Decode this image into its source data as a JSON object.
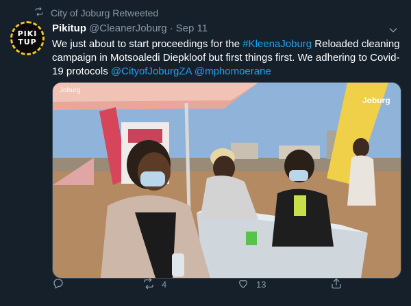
{
  "retweet_context": {
    "text": "City of Joburg Retweeted",
    "icon": "retweet-icon"
  },
  "author": {
    "display_name": "Pikitup",
    "handle": "@CleanerJoburg",
    "separator": "·",
    "date": "Sep 11",
    "avatar_line1": "PIKI",
    "avatar_line2": "TUP"
  },
  "tweet": {
    "text_part1": "We just about to start proceedings for the ",
    "hashtag": "#KleenaJoburg",
    "text_part2": " Reloaded cleaning campaign in Motsoaledi Diepkloof but first things first. We adhering to Covid-19 protocols ",
    "mention1": "@CityofJoburgZA",
    "space": " ",
    "mention2": "@mphomoerane"
  },
  "media": {
    "banner_text_left": "Joburg",
    "banner_text_right": "Joburg"
  },
  "actions": {
    "reply_count": "",
    "retweet_count": "4",
    "like_count": "13"
  },
  "colors": {
    "background": "#15202b",
    "muted": "#8899a6",
    "link": "#1da1f2"
  }
}
